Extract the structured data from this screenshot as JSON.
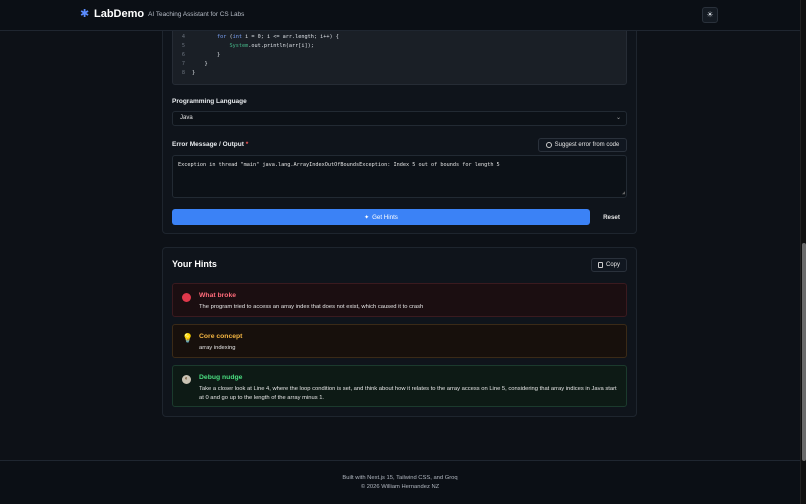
{
  "header": {
    "brand": "LabDemo",
    "tagline": "AI Teaching Assistant for CS Labs",
    "theme_icon": "sun-icon"
  },
  "code": {
    "lines": [
      {
        "num": "4",
        "pre": "        ",
        "kw": "for",
        "mid": " (",
        "kw2": "int",
        "post": " i = 0; i <= arr.length; i++) {"
      },
      {
        "num": "5",
        "pre": "            ",
        "fn": "System",
        "post": ".out.println(arr[i]);"
      },
      {
        "num": "6",
        "text": "        }"
      },
      {
        "num": "7",
        "text": "    }"
      },
      {
        "num": "8",
        "text": "}"
      }
    ]
  },
  "form": {
    "language_label": "Programming Language",
    "language_value": "Java",
    "error_label": "Error Message / Output",
    "required_mark": "*",
    "suggest_label": "Suggest error from code",
    "error_value": "Exception in thread \"main\" java.lang.ArrayIndexOutOfBoundsException: Index 5 out of bounds for length 5",
    "get_hints_label": "Get Hints",
    "reset_label": "Reset"
  },
  "hints": {
    "title": "Your Hints",
    "copy_label": "Copy",
    "items": [
      {
        "title": "What broke",
        "text": "The program tried to access an array index that does not exist, which caused it to crash"
      },
      {
        "title": "Core concept",
        "text": "array indexing"
      },
      {
        "title": "Debug nudge",
        "text": "Take a closer look at Line 4, where the loop condition is set, and think about how it relates to the array access on Line 5, considering that array indices in Java start at 0 and go up to the length of the array minus 1."
      }
    ]
  },
  "footer": {
    "line1": "Built with Next.js 15, Tailwind CSS, and Groq",
    "line2": "© 2026 William Hernandez NZ"
  }
}
